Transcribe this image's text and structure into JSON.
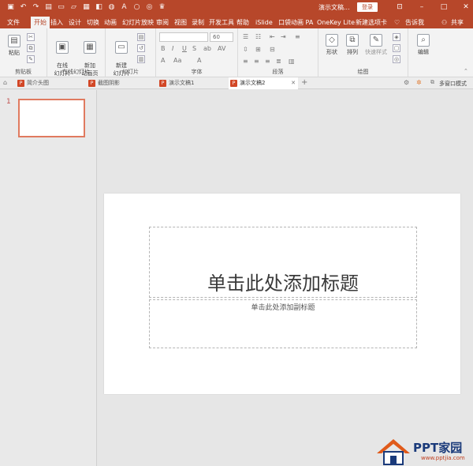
{
  "titlebar": {
    "doc_title": "演示文稿...",
    "login_label": "登录",
    "qat_icons": [
      "save-icon",
      "undo-icon",
      "redo-icon",
      "presenter-icon",
      "new-icon",
      "open-icon",
      "print-icon",
      "shape-icon",
      "fill-icon",
      "text-icon",
      "circle-icon",
      "format-icon",
      "crown-icon"
    ]
  },
  "tabs": [
    {
      "label": "文件",
      "active": false
    },
    {
      "label": "开始",
      "active": true
    },
    {
      "label": "插入",
      "active": false
    },
    {
      "label": "设计",
      "active": false
    },
    {
      "label": "切换",
      "active": false
    },
    {
      "label": "动画",
      "active": false
    },
    {
      "label": "幻灯片放映",
      "active": false
    },
    {
      "label": "审阅",
      "active": false
    },
    {
      "label": "视图",
      "active": false
    },
    {
      "label": "录制",
      "active": false
    },
    {
      "label": "开发工具",
      "active": false
    },
    {
      "label": "帮助",
      "active": false
    },
    {
      "label": "iSlide",
      "active": false
    },
    {
      "label": "口袋动画 PA",
      "active": false
    },
    {
      "label": "OneKey Lite",
      "active": false
    },
    {
      "label": "新建选项卡",
      "active": false
    },
    {
      "label": "告诉我",
      "active": false
    },
    {
      "label": "共享",
      "active": false
    }
  ],
  "ribbon": {
    "clipboard": {
      "paste": "粘贴",
      "group": "剪贴板"
    },
    "online_slides": {
      "online": "在线\n幻灯片",
      "add_anim": "新加\n动画页",
      "group": "在线幻灯片"
    },
    "slides": {
      "new_slide": "新建\n幻灯片",
      "group": "幻灯片"
    },
    "font": {
      "name": "",
      "size": "60",
      "group": "字体",
      "buttons": [
        "B",
        "I",
        "U",
        "S",
        "ab",
        "AV",
        "Aa",
        "A",
        "A"
      ]
    },
    "paragraph": {
      "group": "段落"
    },
    "drawing": {
      "shape": "形状",
      "arrange": "排列",
      "quick_style": "快速样式",
      "group": "绘图"
    },
    "editing": {
      "label": "编辑"
    }
  },
  "doc_tabs": [
    {
      "label": "简介头图",
      "active": false
    },
    {
      "label": "截图阴影",
      "active": false
    },
    {
      "label": "演示文稿1",
      "active": false
    },
    {
      "label": "演示文稿2",
      "active": true
    }
  ],
  "doc_tabs_right": {
    "multi_window": "多窗口模式"
  },
  "thumbnails": [
    {
      "number": "1"
    }
  ],
  "slide": {
    "title_placeholder": "单击此处添加标题",
    "subtitle_placeholder": "单击此处添加副标题"
  },
  "watermark": {
    "text": "PPT家园",
    "url": "www.pptjia.com"
  },
  "colors": {
    "accent": "#b7472a",
    "thumb_border": "#e07a5f"
  }
}
